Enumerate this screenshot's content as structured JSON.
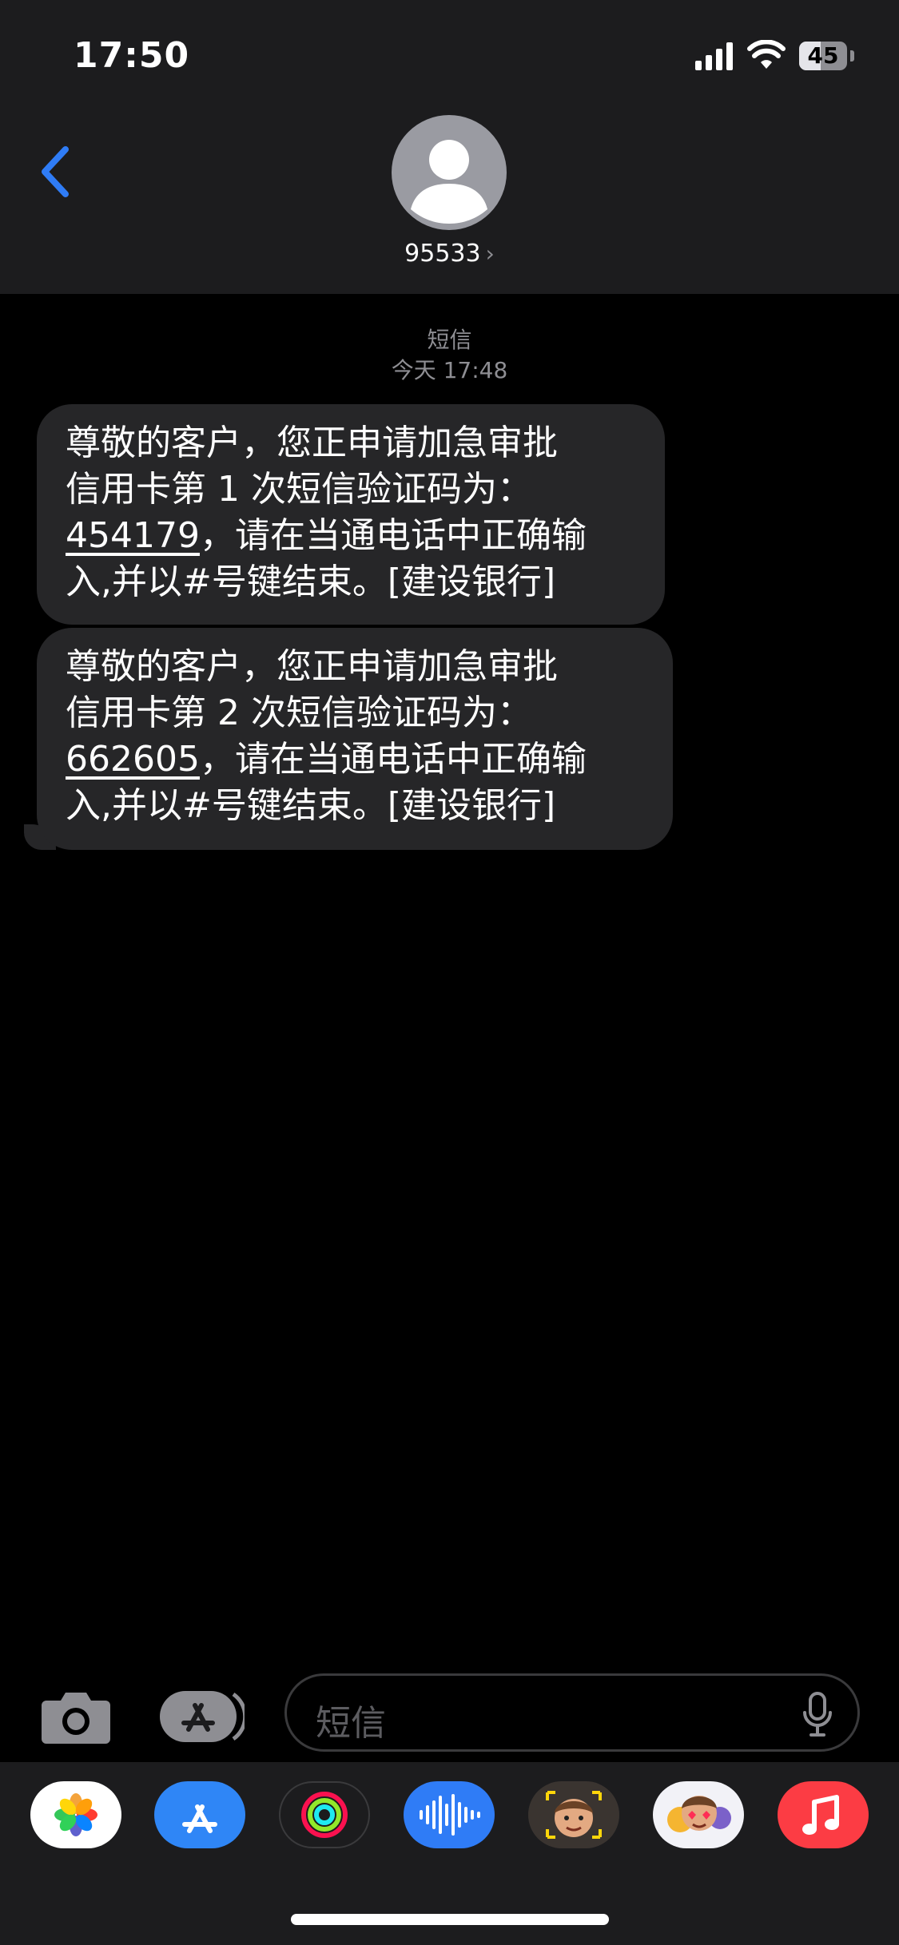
{
  "status_bar": {
    "time": "17:50",
    "battery": "45",
    "battery_level": 0.45
  },
  "header": {
    "contact": "95533",
    "chevron": "›"
  },
  "conversation": {
    "service_label": "短信",
    "timestamp": "今天 17:48",
    "messages": [
      {
        "line1": "尊敬的客户，您正申请加急审批",
        "line2": "信用卡第 1 次短信验证码为：",
        "code": "454179",
        "line3_rest": "，请在当通电话中正确输",
        "line4": "入,并以#号键结束。[建设银行]"
      },
      {
        "line1": "尊敬的客户，您正申请加急审批",
        "line2": "信用卡第 2 次短信验证码为：",
        "code": "662605",
        "line3_rest": "，请在当通电话中正确输",
        "line4": "入,并以#号键结束。[建设银行]"
      }
    ]
  },
  "input": {
    "placeholder": "短信"
  },
  "icons": {
    "back": "chevron-left-icon",
    "avatar": "person-icon",
    "camera": "camera-icon",
    "apps": "app-store-icon",
    "mic": "microphone-icon"
  },
  "app_drawer": [
    "photos",
    "app-store",
    "activity",
    "audio-message",
    "memoji",
    "animoji",
    "music"
  ],
  "colors": {
    "accent": "#2f7cf6",
    "bubble": "#262628",
    "header": "#1c1c1e",
    "secondary_text": "#8e8e93"
  }
}
